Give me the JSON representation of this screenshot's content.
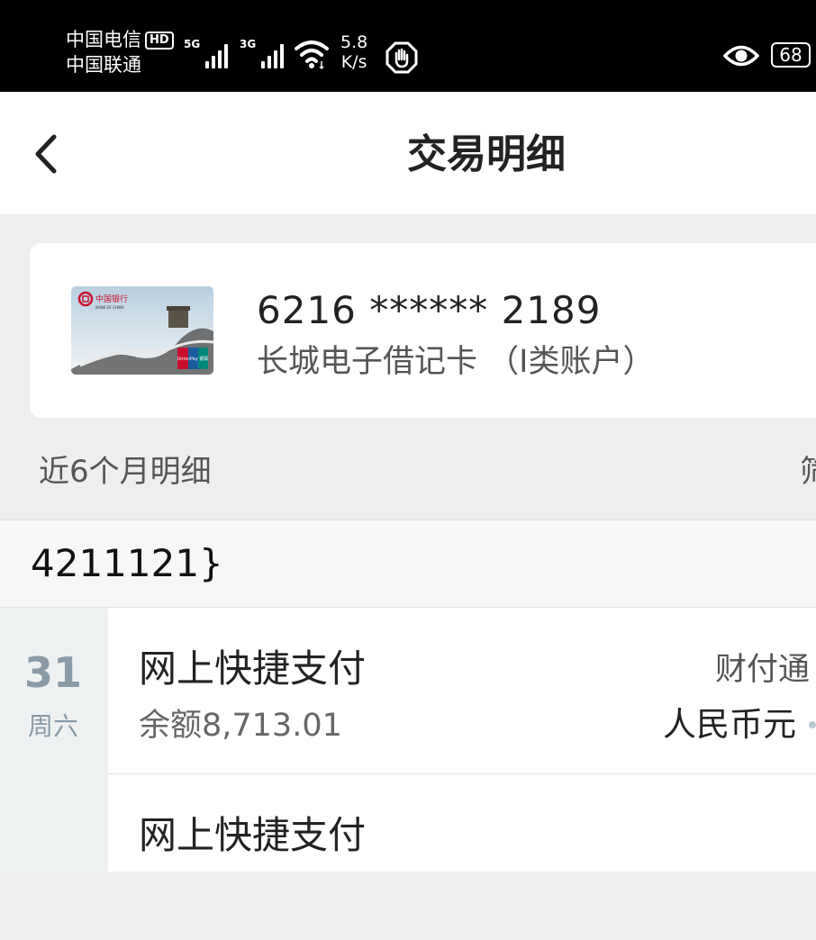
{
  "status_bar": {
    "carrier_1": "中国电信",
    "hd_badge": "HD",
    "carrier_2": "中国联通",
    "sim1_network": "5G",
    "sim2_network": "3G",
    "speed_value": "5.8",
    "speed_unit": "K/s",
    "battery": "68"
  },
  "nav": {
    "title": "交易明细"
  },
  "card": {
    "number": "6216 ****** 2189",
    "type": "长城电子借记卡 （I类账户）",
    "bank_logo_text": "中国银行",
    "bank_en": "BANK OF CHINA",
    "unionpay": "UnionPay 银联"
  },
  "section": {
    "label": "近6个月明细",
    "filter": "筛"
  },
  "month_header": "4211121}",
  "date": {
    "day": "31",
    "weekday": "周六"
  },
  "transactions": [
    {
      "title": "网上快捷支付",
      "balance": "余额8,713.01",
      "merchant": "财付通",
      "currency": "人民币元"
    },
    {
      "title": "网上快捷支付"
    }
  ]
}
